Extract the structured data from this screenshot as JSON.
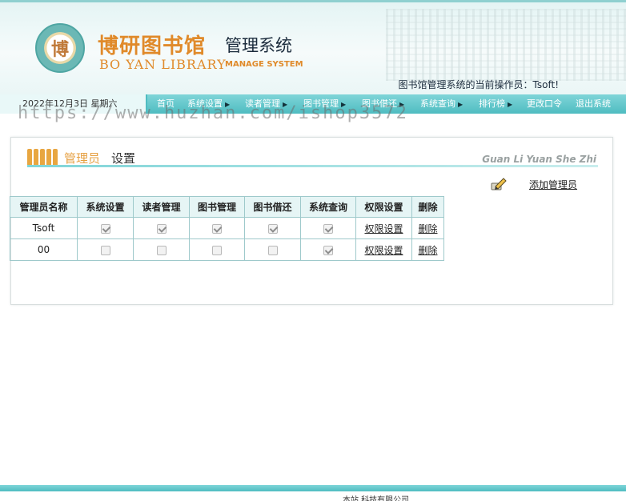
{
  "header": {
    "seal_char": "博",
    "brand_cn": "博研图书馆",
    "brand_cn_suffix": "管理系统",
    "brand_en": "BO YAN LIBRARY",
    "brand_en_suffix": "MANAGE SYSTEM",
    "operator_text": "图书馆管理系统的当前操作员：Tsoft!"
  },
  "navbar": {
    "date_text": "2022年12月3日  星期六",
    "items": [
      {
        "label": "首页",
        "arrow": false
      },
      {
        "label": "系统设置",
        "arrow": true
      },
      {
        "label": "读者管理",
        "arrow": true
      },
      {
        "label": "图书管理",
        "arrow": true
      },
      {
        "label": "图书借还",
        "arrow": true
      },
      {
        "label": "系统查询",
        "arrow": true
      },
      {
        "label": "排行榜",
        "arrow": true
      },
      {
        "label": "更改口令",
        "arrow": false
      },
      {
        "label": "退出系统",
        "arrow": false
      }
    ]
  },
  "panel": {
    "title_highlight": "管理员",
    "title_rest": "设置",
    "pinyin": "Guan Li Yuan She Zhi",
    "add_admin_label": "添加管理员"
  },
  "table": {
    "headers": [
      "管理员名称",
      "系统设置",
      "读者管理",
      "图书管理",
      "图书借还",
      "系统查询",
      "权限设置",
      "删除"
    ],
    "rows": [
      {
        "name": "Tsoft",
        "perms": [
          true,
          true,
          true,
          true,
          true
        ],
        "perm_link": "权限设置",
        "delete_link": "删除"
      },
      {
        "name": "00",
        "perms": [
          false,
          false,
          false,
          false,
          true
        ],
        "perm_link": "权限设置",
        "delete_link": "删除"
      }
    ]
  },
  "footer": {
    "text": "本站   科技有限公司"
  },
  "watermark": "https://www.huzhan.com/ishop3572",
  "colors": {
    "nav_teal": "#4fbcc1",
    "brand_orange": "#e08a2a",
    "header_bg": "#e4f4f4"
  }
}
